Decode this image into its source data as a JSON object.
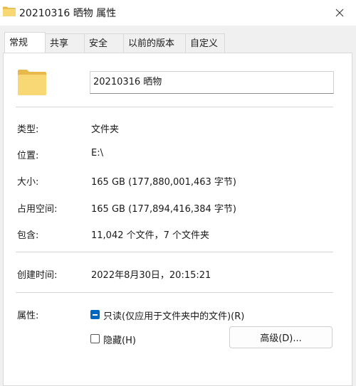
{
  "window": {
    "title": "20210316 晒物 属性",
    "close_icon": "close-icon"
  },
  "tabs": [
    {
      "label": "常规",
      "active": true
    },
    {
      "label": "共享",
      "active": false
    },
    {
      "label": "安全",
      "active": false
    },
    {
      "label": "以前的版本",
      "active": false
    },
    {
      "label": "自定义",
      "active": false
    }
  ],
  "general": {
    "name_value": "20210316 晒物",
    "rows1": [
      {
        "label": "类型:",
        "value": "文件夹"
      },
      {
        "label": "位置:",
        "value": "E:\\"
      },
      {
        "label": "大小:",
        "value": "165 GB (177,880,001,463 字节)"
      },
      {
        "label": "占用空间:",
        "value": "165 GB (177,894,416,384 字节)"
      },
      {
        "label": "包含:",
        "value": "11,042 个文件，7 个文件夹"
      }
    ],
    "created": {
      "label": "创建时间:",
      "value": "2022年8月30日，20:15:21"
    },
    "attributes": {
      "label": "属性:",
      "readonly": "只读(仅应用于文件夹中的文件)(R)",
      "hidden": "隐藏(H)",
      "advanced_button": "高级(D)..."
    }
  },
  "colors": {
    "accent": "#0067c0",
    "folder": "#f8d775"
  }
}
